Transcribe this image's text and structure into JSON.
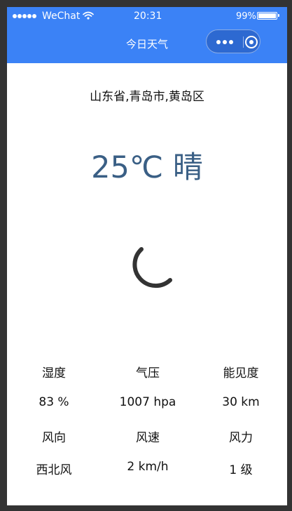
{
  "status_bar": {
    "carrier": "WeChat",
    "time": "20:31",
    "battery_percent": "99%",
    "battery_level": 0.99
  },
  "nav": {
    "title": "今日天气"
  },
  "weather": {
    "location": "山东省,青岛市,黄岛区",
    "temperature": "25℃",
    "condition": "晴",
    "icon": "moon-icon"
  },
  "stats": {
    "row1": [
      {
        "label": "湿度"
      },
      {
        "label": "气压"
      },
      {
        "label": "能见度"
      }
    ],
    "row2": [
      {
        "value": "83 %"
      },
      {
        "value": "1007 hpa"
      },
      {
        "value": "30 km"
      }
    ],
    "row3": [
      {
        "label": "风向"
      },
      {
        "label": "风速"
      },
      {
        "label": "风力"
      }
    ],
    "row4": [
      {
        "value": "西北风"
      },
      {
        "value": "2 km/h"
      },
      {
        "value": "1 级"
      }
    ]
  },
  "colors": {
    "nav_bg": "#3b82f6",
    "temperature_text": "#3a5f85",
    "icon_stroke": "#333333"
  }
}
